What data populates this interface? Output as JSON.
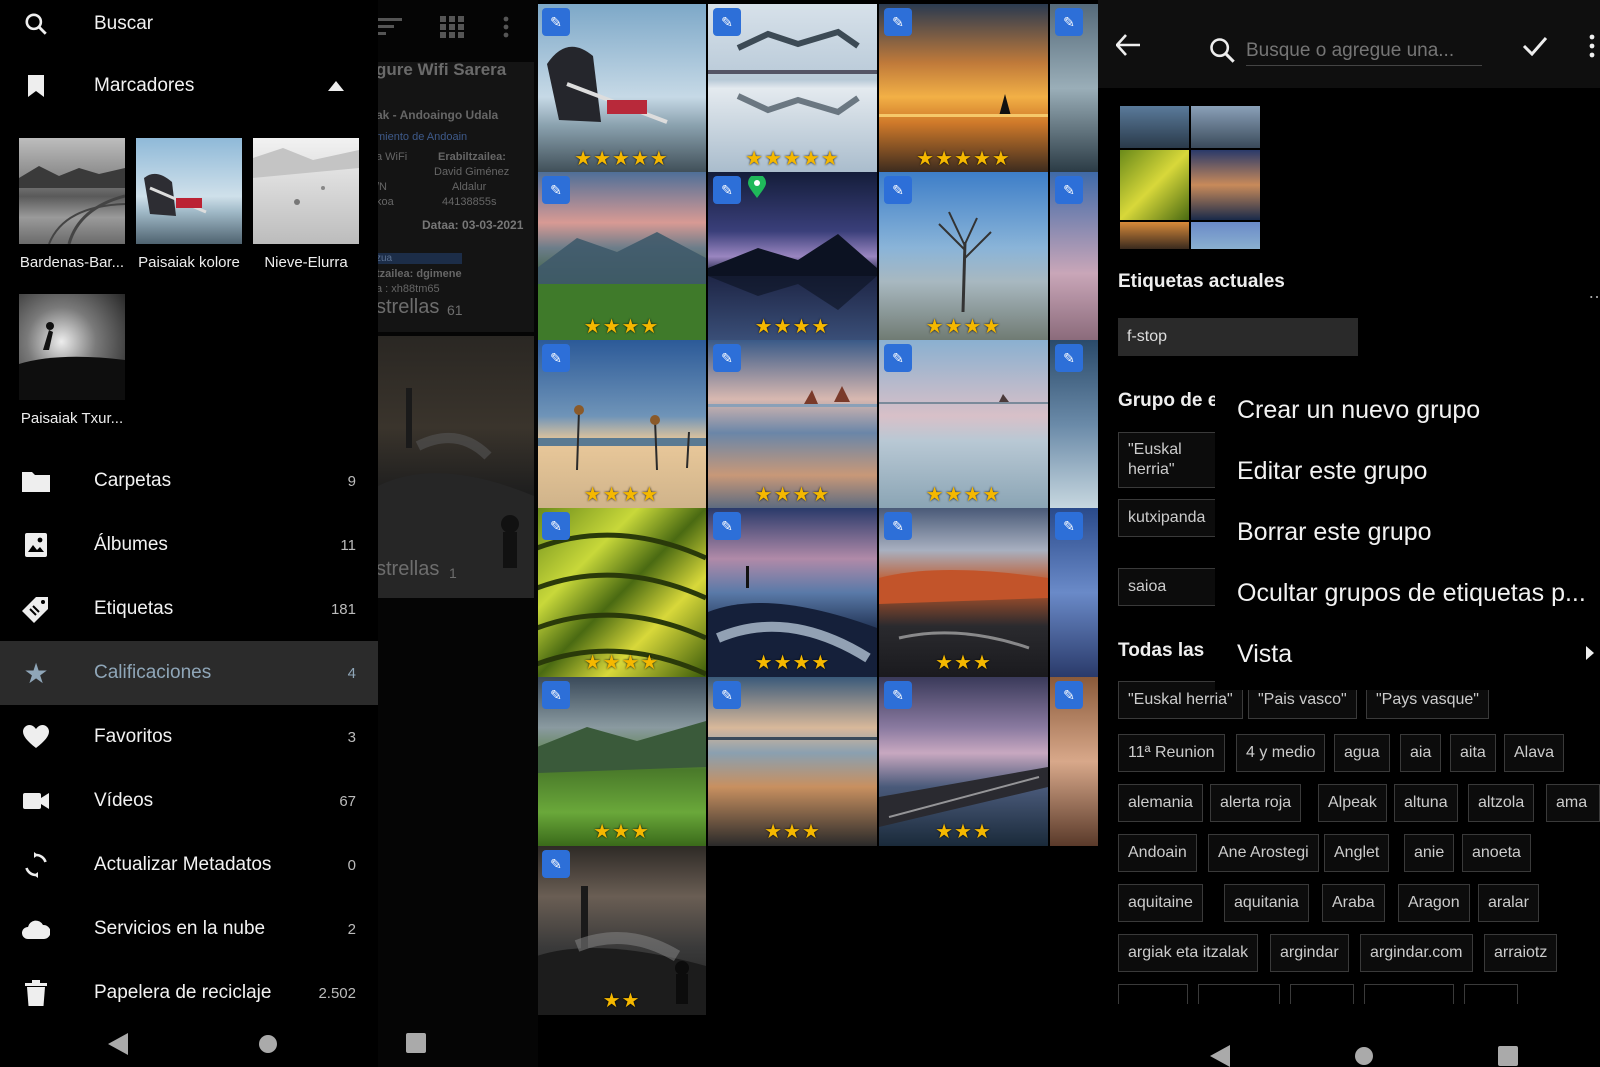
{
  "drawer": {
    "search_label": "Buscar",
    "bookmarks_label": "Marcadores",
    "bookmarks": [
      {
        "label": "Bardenas-Bar..."
      },
      {
        "label": "Paisaiak kolore"
      },
      {
        "label": "Nieve-Elurra"
      },
      {
        "label": "Paisaiak Txur..."
      }
    ],
    "items": [
      {
        "label": "Carpetas",
        "count": "9",
        "icon": "folder-icon"
      },
      {
        "label": "Álbumes",
        "count": "11",
        "icon": "album-icon"
      },
      {
        "label": "Etiquetas",
        "count": "181",
        "icon": "tag-icon"
      },
      {
        "label": "Calificaciones",
        "count": "4",
        "icon": "star-icon"
      },
      {
        "label": "Favoritos",
        "count": "3",
        "icon": "heart-icon"
      },
      {
        "label": "Vídeos",
        "count": "67",
        "icon": "video-icon"
      },
      {
        "label": "Actualizar Metadatos",
        "count": "0",
        "icon": "sync-icon"
      },
      {
        "label": "Servicios en la nube",
        "count": "2",
        "icon": "cloud-icon"
      },
      {
        "label": "Papelera de reciclaje",
        "count": "2.502",
        "icon": "trash-icon"
      }
    ],
    "active_item": "Calificaciones"
  },
  "behind": {
    "heading": "gure Wifi Sarera",
    "line1": "ak - Andoaingo Udala",
    "line2": "miento de Andoain",
    "line3a": "a WiFi",
    "line3b": "Erabiltzailea:",
    "line4": "David Giménez",
    "line5a": "/N",
    "line5b": "Aldalur",
    "line6a": "koa",
    "line6b": "44138855s",
    "date": "Dataa: 03-03-2021",
    "zua": "zua",
    "user": "tzailea: dgimene",
    "pass": "a : xh88tm65",
    "group1_label": "strellas",
    "group1_count": "61",
    "group2_label": "strellas",
    "group2_count": "1"
  },
  "grid": {
    "rows": [
      [
        5,
        5,
        5
      ],
      [
        4,
        4,
        4
      ],
      [
        4,
        4,
        4
      ],
      [
        4,
        4,
        3
      ],
      [
        3,
        3,
        3
      ],
      [
        2
      ]
    ]
  },
  "tags": {
    "search_placeholder": "Busque o agregue una...",
    "current_label": "Etiquetas actuales",
    "current_tag": "f-stop",
    "group_label": "Grupo de e",
    "group_chips": [
      "\"Euskal herria\"",
      "kutxipanda",
      "saioa"
    ],
    "all_label": "Todas las",
    "all_chips": [
      [
        "\"Euskal herria\"",
        "\"Pais vasco\"",
        "\"Pays vasque\""
      ],
      [
        "11ª Reunion",
        "4 y medio",
        "agua",
        "aia",
        "aita",
        "Alava"
      ],
      [
        "alemania",
        "alerta roja",
        "Alpeak",
        "altuna",
        "altzola",
        "ama"
      ],
      [
        "Andoain",
        "Ane Arostegi",
        "Anglet",
        "anie",
        "anoeta"
      ],
      [
        "aquitaine",
        "aquitania",
        "Araba",
        "Aragon",
        "aralar"
      ],
      [
        "argiak eta itzalak",
        "argindar",
        "argindar.com",
        "arraiotz"
      ]
    ],
    "menu": [
      "Crear un nuevo grupo",
      "Editar este grupo",
      "Borrar este grupo",
      "Ocultar grupos de etiquetas p...",
      "Vista"
    ]
  }
}
